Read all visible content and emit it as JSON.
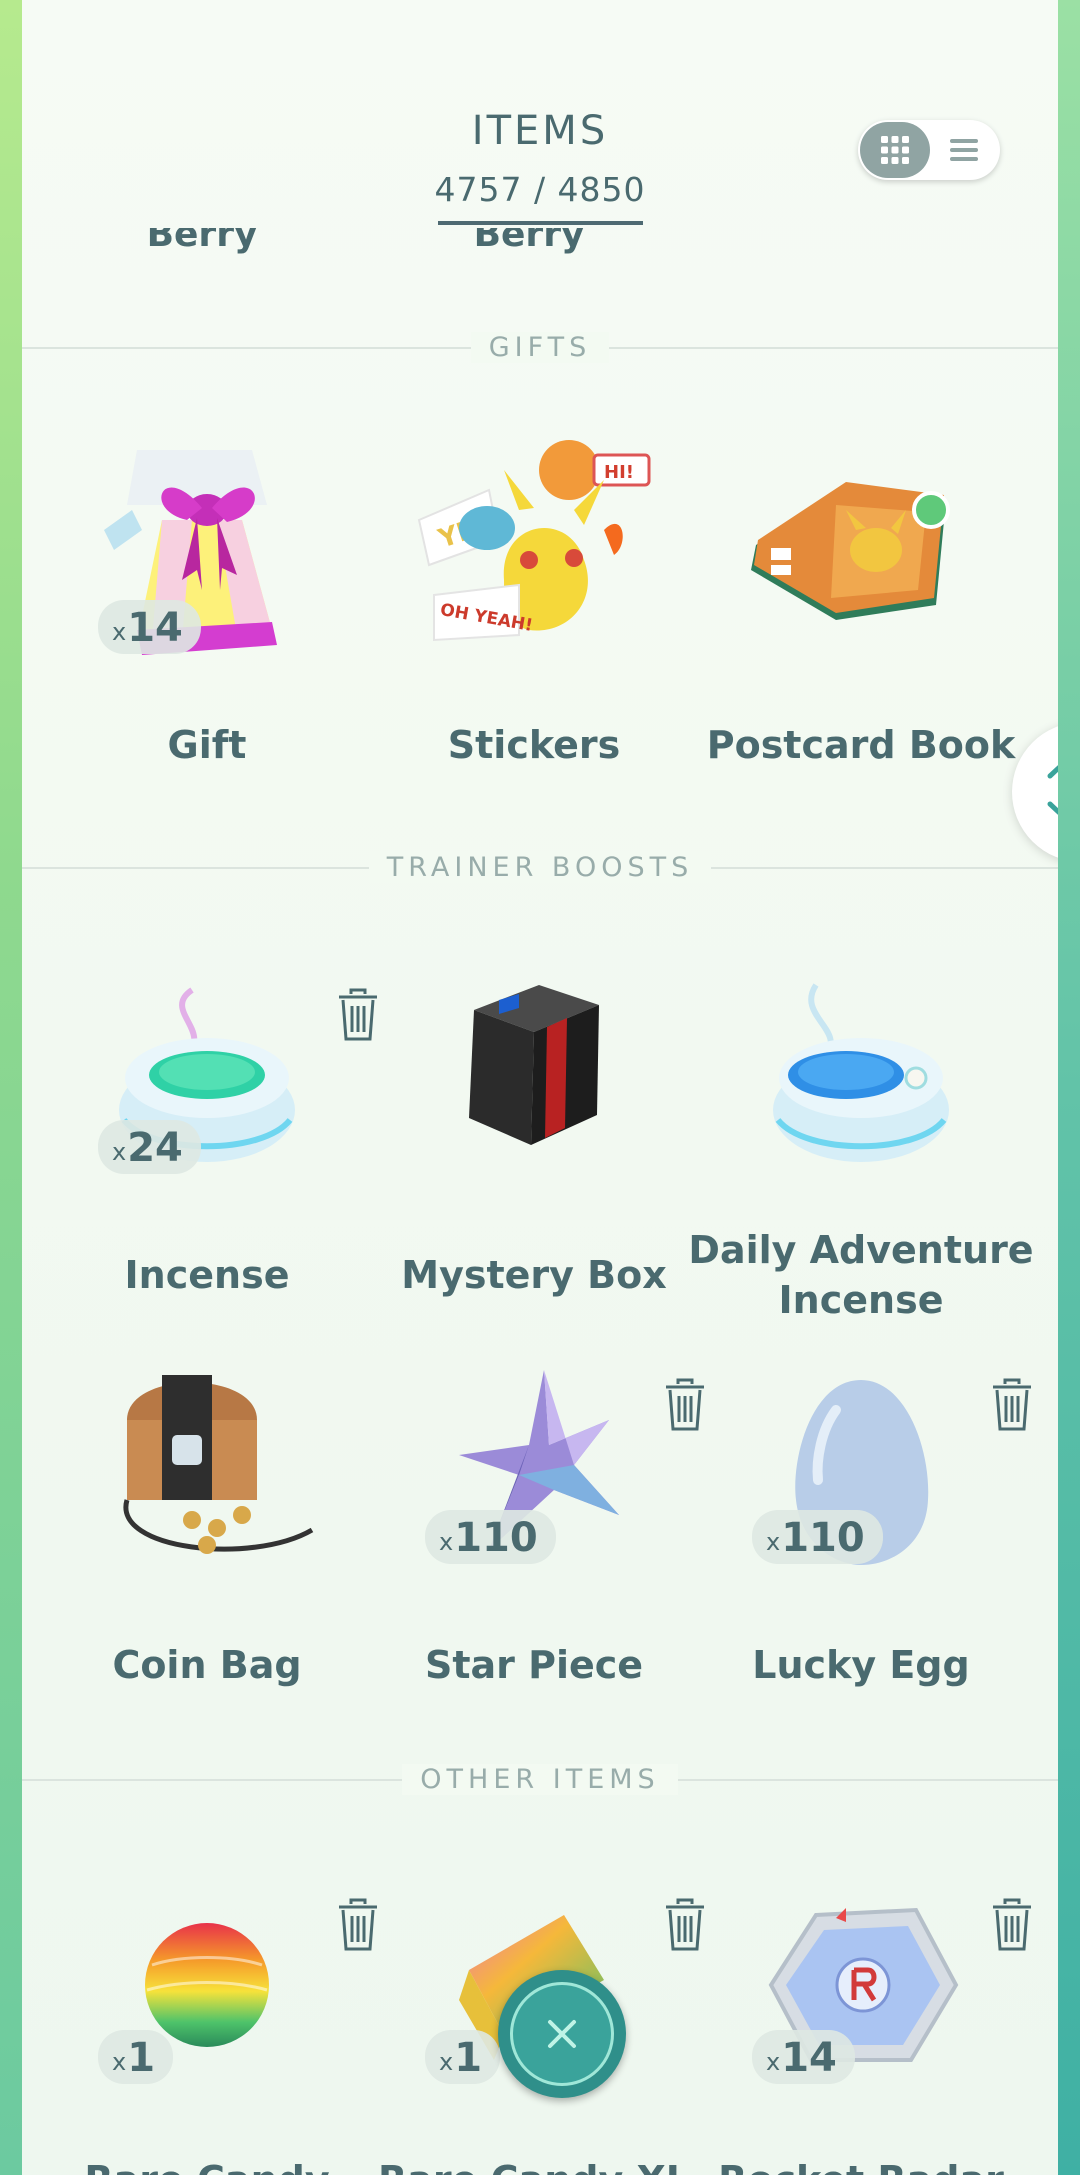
{
  "header": {
    "title": "ITEMS",
    "count": "4757 / 4850"
  },
  "view_toggle": {
    "active": "grid"
  },
  "partial_row": [
    "Berry",
    "Berry"
  ],
  "sections": [
    {
      "label": "GIFTS"
    },
    {
      "label": "TRAINER BOOSTS"
    },
    {
      "label": "OTHER ITEMS"
    }
  ],
  "items": {
    "gift": {
      "name": "Gift",
      "count": "14"
    },
    "stickers": {
      "name": "Stickers"
    },
    "postcard_book": {
      "name": "Postcard Book"
    },
    "incense": {
      "name": "Incense",
      "count": "24"
    },
    "mystery_box": {
      "name": "Mystery Box"
    },
    "daily_adventure_incense": {
      "name": "Daily Adventure Incense"
    },
    "coin_bag": {
      "name": "Coin Bag"
    },
    "star_piece": {
      "name": "Star Piece",
      "count": "110"
    },
    "lucky_egg": {
      "name": "Lucky Egg",
      "count": "110"
    },
    "rare_candy": {
      "name": "Rare Candy",
      "count": "1"
    },
    "rare_candy_xl": {
      "name": "Rare Candy XL",
      "count": "1"
    },
    "rocket_radar": {
      "name": "Rocket Radar",
      "count": "14"
    }
  },
  "sticker_texts": {
    "yes": "YES!",
    "hi": "HI!",
    "oh_yeah": "OH YEAH!"
  },
  "badge_prefix": "x",
  "colors": {
    "text": "#4a6a6f",
    "accent": "#3aa39b",
    "section": "#98acaa"
  },
  "icons": [
    "grid-icon",
    "list-icon",
    "trash-icon",
    "chevron-up-icon",
    "chevron-down-icon",
    "close-icon"
  ]
}
